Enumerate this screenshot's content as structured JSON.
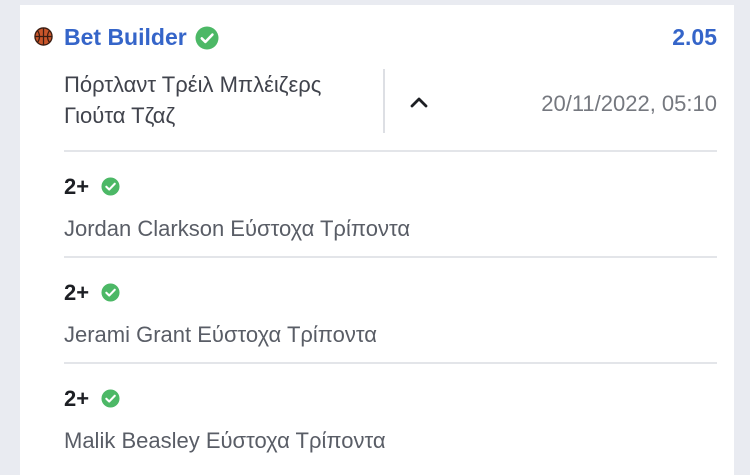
{
  "bet": {
    "title": "Bet Builder",
    "odds": "2.05",
    "sport_icon": "basketball-icon",
    "status_icon": "check-circle-icon",
    "accent_color": "#3565c9",
    "success_color": "#4cb866",
    "event": {
      "home_team": "Πόρτλαντ Τρέιλ Μπλέιζερς",
      "away_team": "Γιούτα Τζαζ",
      "datetime": "20/11/2022, 05:10",
      "toggle_icon": "chevron-up-icon"
    },
    "legs": [
      {
        "value": "2+",
        "market": "Jordan Clarkson Εύστοχα Τρίποντα"
      },
      {
        "value": "2+",
        "market": "Jerami Grant Εύστοχα Τρίποντα"
      },
      {
        "value": "2+",
        "market": "Malik Beasley Εύστοχα Τρίποντα"
      }
    ]
  }
}
